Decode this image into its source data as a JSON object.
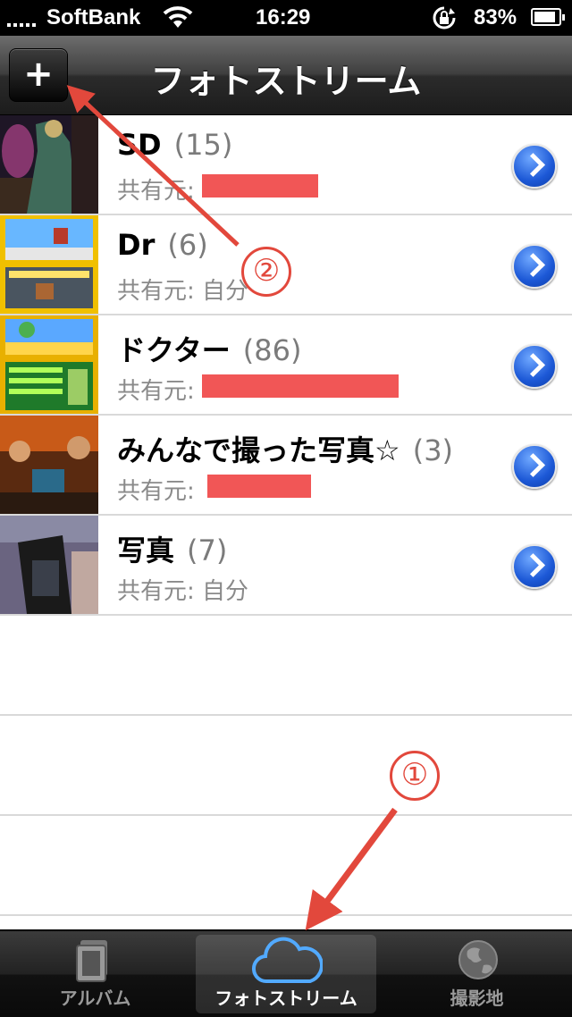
{
  "status_bar": {
    "carrier": "SoftBank",
    "time": "16:29",
    "battery": "83%"
  },
  "nav": {
    "title": "フォトストリーム",
    "add_label": "+"
  },
  "streams": [
    {
      "title": "SD",
      "count": "(15)",
      "shared_by": "共有元:",
      "owner": "",
      "redacted": true
    },
    {
      "title": "Dr",
      "count": "(6)",
      "shared_by": "共有元: 自分",
      "owner": "",
      "redacted": false
    },
    {
      "title": "ドクター",
      "count": "(86)",
      "shared_by": "共有元:",
      "owner": "",
      "redacted": true
    },
    {
      "title": "みんなで撮った写真☆",
      "count": "(3)",
      "shared_by": "共有元:",
      "owner": "",
      "redacted": true
    },
    {
      "title": "写真",
      "count": "(7)",
      "shared_by": "共有元: 自分",
      "owner": "",
      "redacted": false
    }
  ],
  "tabs": [
    {
      "label": "アルバム",
      "icon": "albums-icon",
      "active": false
    },
    {
      "label": "フォトストリーム",
      "icon": "cloud-icon",
      "active": true
    },
    {
      "label": "撮影地",
      "icon": "globe-icon",
      "active": false
    }
  ],
  "annotations": {
    "marker_1": "①",
    "marker_2": "②",
    "color": "#e2483c"
  },
  "colors": {
    "accent_blue": "#1c58d6",
    "redaction": "#ef4444"
  }
}
